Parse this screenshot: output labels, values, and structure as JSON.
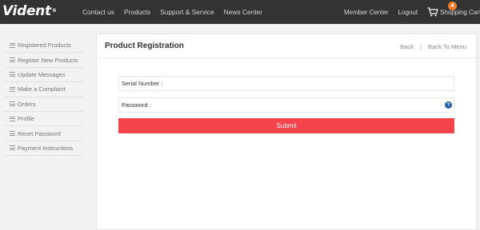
{
  "header": {
    "logo": "Vident",
    "logo_mark": "®",
    "nav": [
      "Contact us",
      "Products",
      "Support & Service",
      "News Center"
    ],
    "member_center": "Member Center",
    "logout": "Logout",
    "cart_label": "Shopping Cart",
    "cart_count": "4"
  },
  "sidebar": {
    "items": [
      {
        "label": "Registered Products"
      },
      {
        "label": "Register New Products"
      },
      {
        "label": "Update Messages"
      },
      {
        "label": "Make a Complaint"
      },
      {
        "label": "Orders"
      },
      {
        "label": "Profile"
      },
      {
        "label": "Reset Password"
      },
      {
        "label": "Payment Instructions"
      }
    ]
  },
  "main": {
    "title": "Product Registration",
    "back": "Back",
    "separator": "|",
    "back_to_menu": "Back To Menu",
    "form": {
      "serial_label": "Serial Number :",
      "serial_value": "",
      "password_label": "Password :",
      "password_value": "",
      "help_glyph": "?",
      "submit_label": "Submit"
    }
  },
  "colors": {
    "topbar": "#333333",
    "submit": "#f5434b",
    "badge": "#f07a2a",
    "help": "#1f5fa8"
  }
}
